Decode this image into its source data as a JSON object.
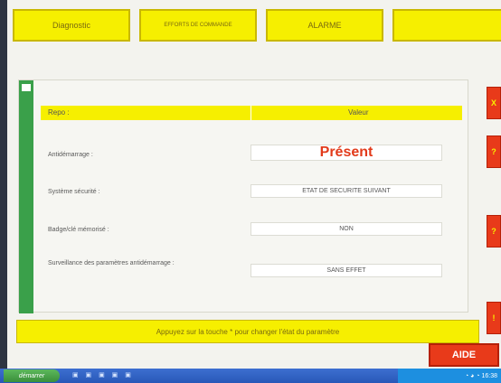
{
  "tabs": [
    {
      "label": "Diagnostic"
    },
    {
      "label": "EFFORTS DE COMMANDE"
    },
    {
      "label": "ALARME"
    },
    {
      "label": ""
    }
  ],
  "table_header": {
    "col1": "Repo :",
    "col2": "Valeur"
  },
  "params": [
    {
      "label": "Antidémarrage :",
      "value": "Présent"
    },
    {
      "label": "Système sécurité :",
      "value": "ETAT DE SECURITE SUIVANT"
    },
    {
      "label": "Badge/clé mémorisé :",
      "value": "NON"
    },
    {
      "label": "Surveillance des paramètres antidémarrage :",
      "value": "SANS EFFET"
    }
  ],
  "hint": "Appuyez sur la touche * pour changer l'état du paramètre",
  "side_buttons": [
    "X",
    "?",
    "?",
    "!"
  ],
  "help_button": "AIDE",
  "taskbar": {
    "start": "démarrer",
    "icons": "▣ ▣ ▣ ▣ ▣",
    "tray": "◔ ◕ ◔ 16:38"
  }
}
